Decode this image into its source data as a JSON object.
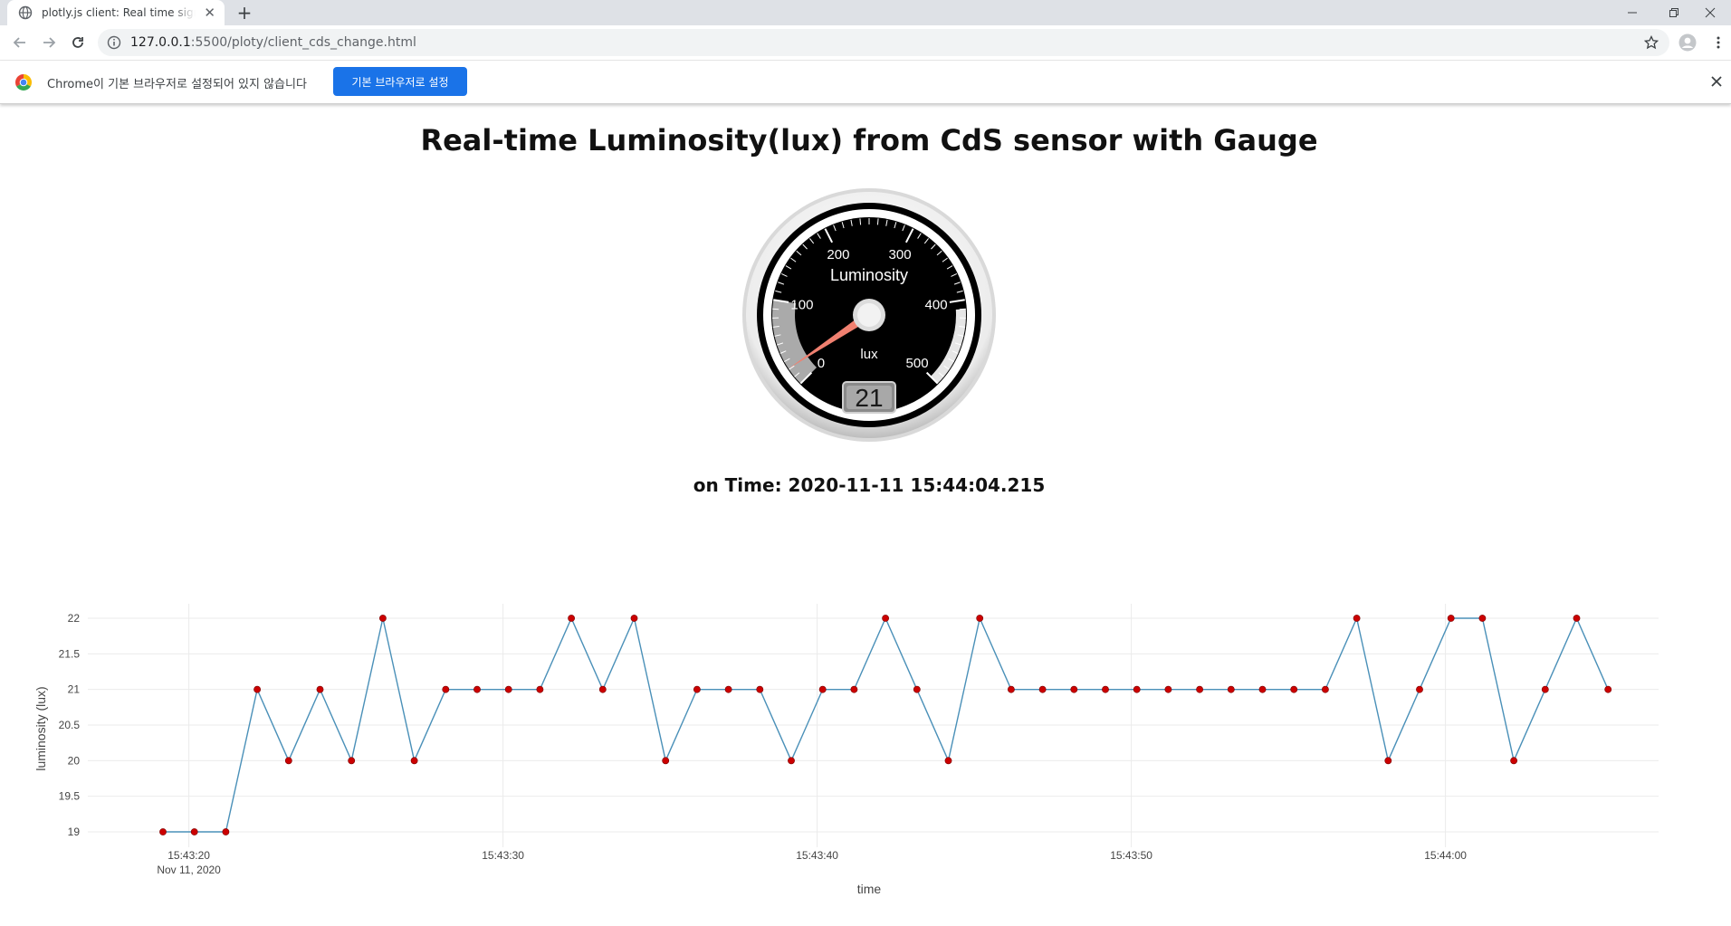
{
  "browser": {
    "tab_title": "plotly.js client: Real time signals",
    "url_host": "127.0.0.1",
    "url_rest": ":5500/ploty/client_cds_change.html",
    "infobar_message": "Chrome이 기본 브라우저로 설정되어 있지 않습니다",
    "infobar_button": "기본 브라우저로 설정"
  },
  "page": {
    "title": "Real-time Luminosity(lux) from CdS sensor with Gauge",
    "time_line": "on Time: 2020-11-11 15:44:04.215"
  },
  "gauge": {
    "title": "Luminosity",
    "units": "lux",
    "min": 0,
    "max": 500,
    "value": 21,
    "value_text": "21",
    "major_ticks": [
      "0",
      "100",
      "200",
      "300",
      "400",
      "500"
    ],
    "highlight_color": "#aaaaaa",
    "needle_color": "#f08070"
  },
  "chart_data": {
    "type": "line",
    "mode": "lines+markers",
    "x": [
      "15:43:20",
      "15:43:21",
      "15:43:22",
      "15:43:23",
      "15:43:24",
      "15:43:25",
      "15:43:26",
      "15:43:27",
      "15:43:28",
      "15:43:29",
      "15:43:30",
      "15:43:31",
      "15:43:32",
      "15:43:33",
      "15:43:34",
      "15:43:35",
      "15:43:36",
      "15:43:37",
      "15:43:38",
      "15:43:39",
      "15:43:40",
      "15:43:41",
      "15:43:42",
      "15:43:43",
      "15:43:44",
      "15:43:45",
      "15:43:46",
      "15:43:47",
      "15:43:48",
      "15:43:49",
      "15:43:50",
      "15:43:51",
      "15:43:52",
      "15:43:53",
      "15:43:54",
      "15:43:55",
      "15:43:56",
      "15:43:57",
      "15:43:58",
      "15:43:59",
      "15:44:00",
      "15:44:01",
      "15:44:02",
      "15:44:03",
      "15:44:04"
    ],
    "y": [
      19,
      19,
      19,
      21,
      20,
      21,
      20,
      22,
      20,
      21,
      21,
      21,
      21,
      22,
      21,
      22,
      20,
      21,
      21,
      21,
      20,
      21,
      21,
      22,
      21,
      20,
      22,
      21,
      21,
      21,
      21,
      21,
      21,
      21,
      21,
      21,
      21,
      21,
      22,
      20,
      21,
      22,
      22,
      20,
      21,
      22,
      21
    ],
    "xlabel": "time",
    "ylabel": "luminosity (lux)",
    "ylim": [
      19,
      22
    ],
    "yticks": [
      "19",
      "19.5",
      "20",
      "20.5",
      "21",
      "21.5",
      "22"
    ],
    "xticks": [
      "15:43:20",
      "15:43:30",
      "15:43:40",
      "15:43:50",
      "15:44:00"
    ],
    "xtick_sub": "Nov 11, 2020",
    "grid": true,
    "line_color": "#4a90b8",
    "marker_color": "#cc0000"
  }
}
